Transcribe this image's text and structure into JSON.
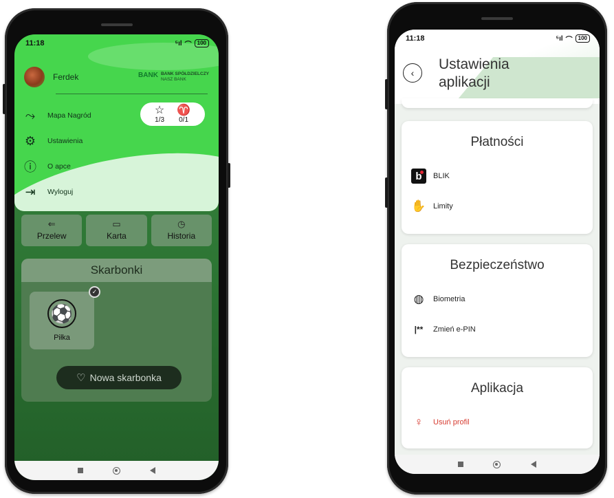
{
  "left_phone": {
    "status": {
      "time": "11:18",
      "signal": "⁵ıl",
      "wifi": "⌒",
      "battery": "100"
    },
    "drawer": {
      "user_name": "Ferdek",
      "bank_line1": "BANK SPÓŁDZIELCZY",
      "bank_line2": "NASZ BANK",
      "bank_mark": "BANK",
      "menu": [
        {
          "label": "Mapa Nagród",
          "icon": "map-route-icon"
        },
        {
          "label": "Ustawienia",
          "icon": "gear-icon"
        },
        {
          "label": "O apce",
          "icon": "info-icon"
        },
        {
          "label": "Wyloguj",
          "icon": "logout-icon"
        }
      ],
      "badges": {
        "stars": "1/3",
        "trophies": "0/1"
      }
    },
    "quick_actions": [
      "Przelew",
      "Karta",
      "Historia"
    ],
    "skarbonki": {
      "title": "Skarbonki",
      "tile_label": "Piłka",
      "new_button": "Nowa skarbonka"
    }
  },
  "right_phone": {
    "status": {
      "time": "11:18",
      "signal": "⁵ıl",
      "wifi": "⌒",
      "battery": "100"
    },
    "title_line1": "Ustawienia",
    "title_line2": "aplikacji",
    "sections": [
      {
        "title": "Płatności",
        "rows": [
          {
            "label": "BLIK",
            "icon": "blik-icon"
          },
          {
            "label": "Limity",
            "icon": "money-icon"
          }
        ]
      },
      {
        "title": "Bezpieczeństwo",
        "rows": [
          {
            "label": "Biometria",
            "icon": "fingerprint-icon"
          },
          {
            "label": "Zmień e-PIN",
            "icon": "pin-icon",
            "icon_text": "|**"
          }
        ]
      },
      {
        "title": "Aplikacja",
        "rows": [
          {
            "label": "Usuń profil",
            "icon": "remove-user-icon"
          }
        ]
      }
    ]
  },
  "colors": {
    "drawer_green": "#46d64d",
    "app_green": "#2c7433",
    "danger": "#d63a2f"
  }
}
